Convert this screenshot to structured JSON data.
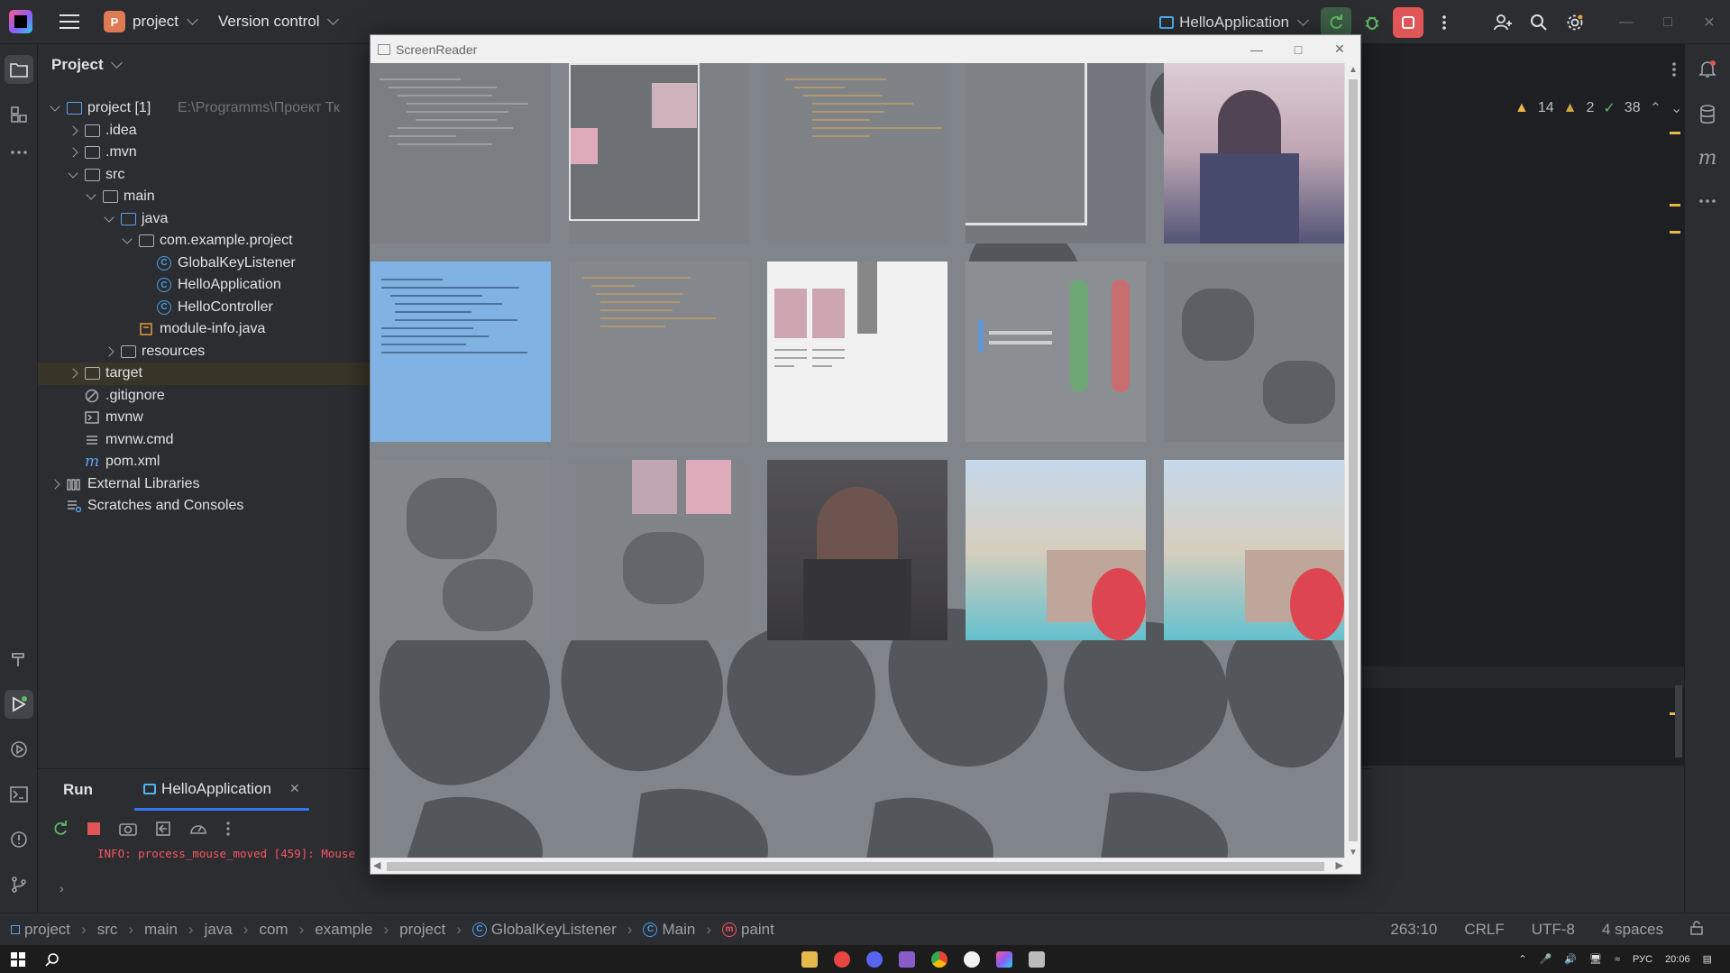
{
  "titlebar": {
    "project_badge": "P",
    "project_name": "project",
    "vcs": "Version control",
    "run_config": "HelloApplication"
  },
  "project_panel": {
    "title": "Project",
    "tree": [
      {
        "label": "project [1]",
        "hint": "E:\\Programms\\Проект Тк",
        "depth": 0,
        "expanded": true,
        "type": "module"
      },
      {
        "label": ".idea",
        "depth": 1,
        "expanded": false,
        "type": "folder"
      },
      {
        "label": ".mvn",
        "depth": 1,
        "expanded": false,
        "type": "folder"
      },
      {
        "label": "src",
        "depth": 1,
        "expanded": true,
        "type": "folder"
      },
      {
        "label": "main",
        "depth": 2,
        "expanded": true,
        "type": "folder"
      },
      {
        "label": "java",
        "depth": 3,
        "expanded": true,
        "type": "source-folder"
      },
      {
        "label": "com.example.project",
        "depth": 4,
        "expanded": true,
        "type": "package"
      },
      {
        "label": "GlobalKeyListener",
        "depth": 5,
        "type": "class"
      },
      {
        "label": "HelloApplication",
        "depth": 5,
        "type": "class"
      },
      {
        "label": "HelloController",
        "depth": 5,
        "type": "class"
      },
      {
        "label": "module-info.java",
        "depth": 4,
        "type": "java-file"
      },
      {
        "label": "resources",
        "depth": 3,
        "expanded": false,
        "type": "resources-folder"
      },
      {
        "label": "target",
        "depth": 1,
        "expanded": false,
        "type": "excluded-folder"
      },
      {
        "label": ".gitignore",
        "depth": 1,
        "type": "ignore-file"
      },
      {
        "label": "mvnw",
        "depth": 1,
        "type": "script-file"
      },
      {
        "label": "mvnw.cmd",
        "depth": 1,
        "type": "text-file"
      },
      {
        "label": "pom.xml",
        "depth": 1,
        "type": "maven-file"
      },
      {
        "label": "External Libraries",
        "depth": 0,
        "expanded": false,
        "type": "libraries"
      },
      {
        "label": "Scratches and Consoles",
        "depth": 0,
        "type": "scratches"
      }
    ]
  },
  "inspections": {
    "warnings": "14",
    "weak_warnings": "2",
    "ok": "38"
  },
  "run_panel": {
    "title": "Run",
    "tab_label": "HelloApplication",
    "console_line": "INFO: process_mouse_moved [459]: Mouse"
  },
  "screenreader": {
    "title": "ScreenReader"
  },
  "statusbar": {
    "breadcrumbs": [
      "project",
      "src",
      "main",
      "java",
      "com",
      "example",
      "project",
      "GlobalKeyListener",
      "Main",
      "paint"
    ],
    "position": "263:10",
    "line_sep": "CRLF",
    "encoding": "UTF-8",
    "indent": "4 spaces"
  },
  "taskbar": {
    "language": "РУС",
    "time": "20:06"
  },
  "colors": {
    "ide_bg": "#2b2d30",
    "accent_blue": "#3574f0",
    "error_red": "#f75464",
    "stop_red": "#e05555",
    "run_green": "#5fb865"
  }
}
